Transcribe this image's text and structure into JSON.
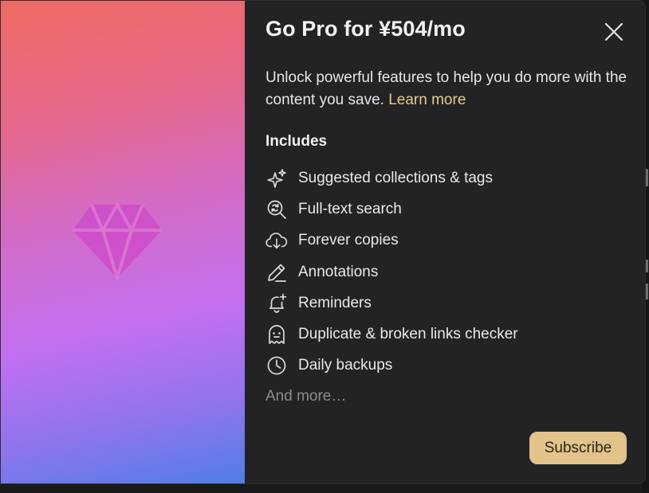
{
  "colors": {
    "panel_background": "#232325",
    "accent_link": "#e8c98f",
    "subscribe_button": "#e2c38c",
    "hero_gradient": [
      "#ee6b63",
      "#e5688b",
      "#c26ff0",
      "#4e7fe6"
    ],
    "diamond": "#cc4fc9"
  },
  "hero": {
    "icon": "diamond-icon"
  },
  "modal": {
    "title": "Go Pro for ¥504/mo",
    "close_icon": "close-icon",
    "description": "Unlock powerful features to help you do more with the content you save.",
    "learn_more": "Learn more",
    "includes_heading": "Includes",
    "features": [
      {
        "icon": "sparkles-icon",
        "label": "Suggested collections & tags"
      },
      {
        "icon": "search-text-icon",
        "label": "Full-text search"
      },
      {
        "icon": "cloud-download-icon",
        "label": "Forever copies"
      },
      {
        "icon": "pencil-icon",
        "label": "Annotations"
      },
      {
        "icon": "bell-plus-icon",
        "label": "Reminders"
      },
      {
        "icon": "ghost-icon",
        "label": "Duplicate & broken links checker"
      },
      {
        "icon": "clock-icon",
        "label": "Daily backups"
      }
    ],
    "more_text": "And more…",
    "subscribe_label": "Subscribe"
  }
}
